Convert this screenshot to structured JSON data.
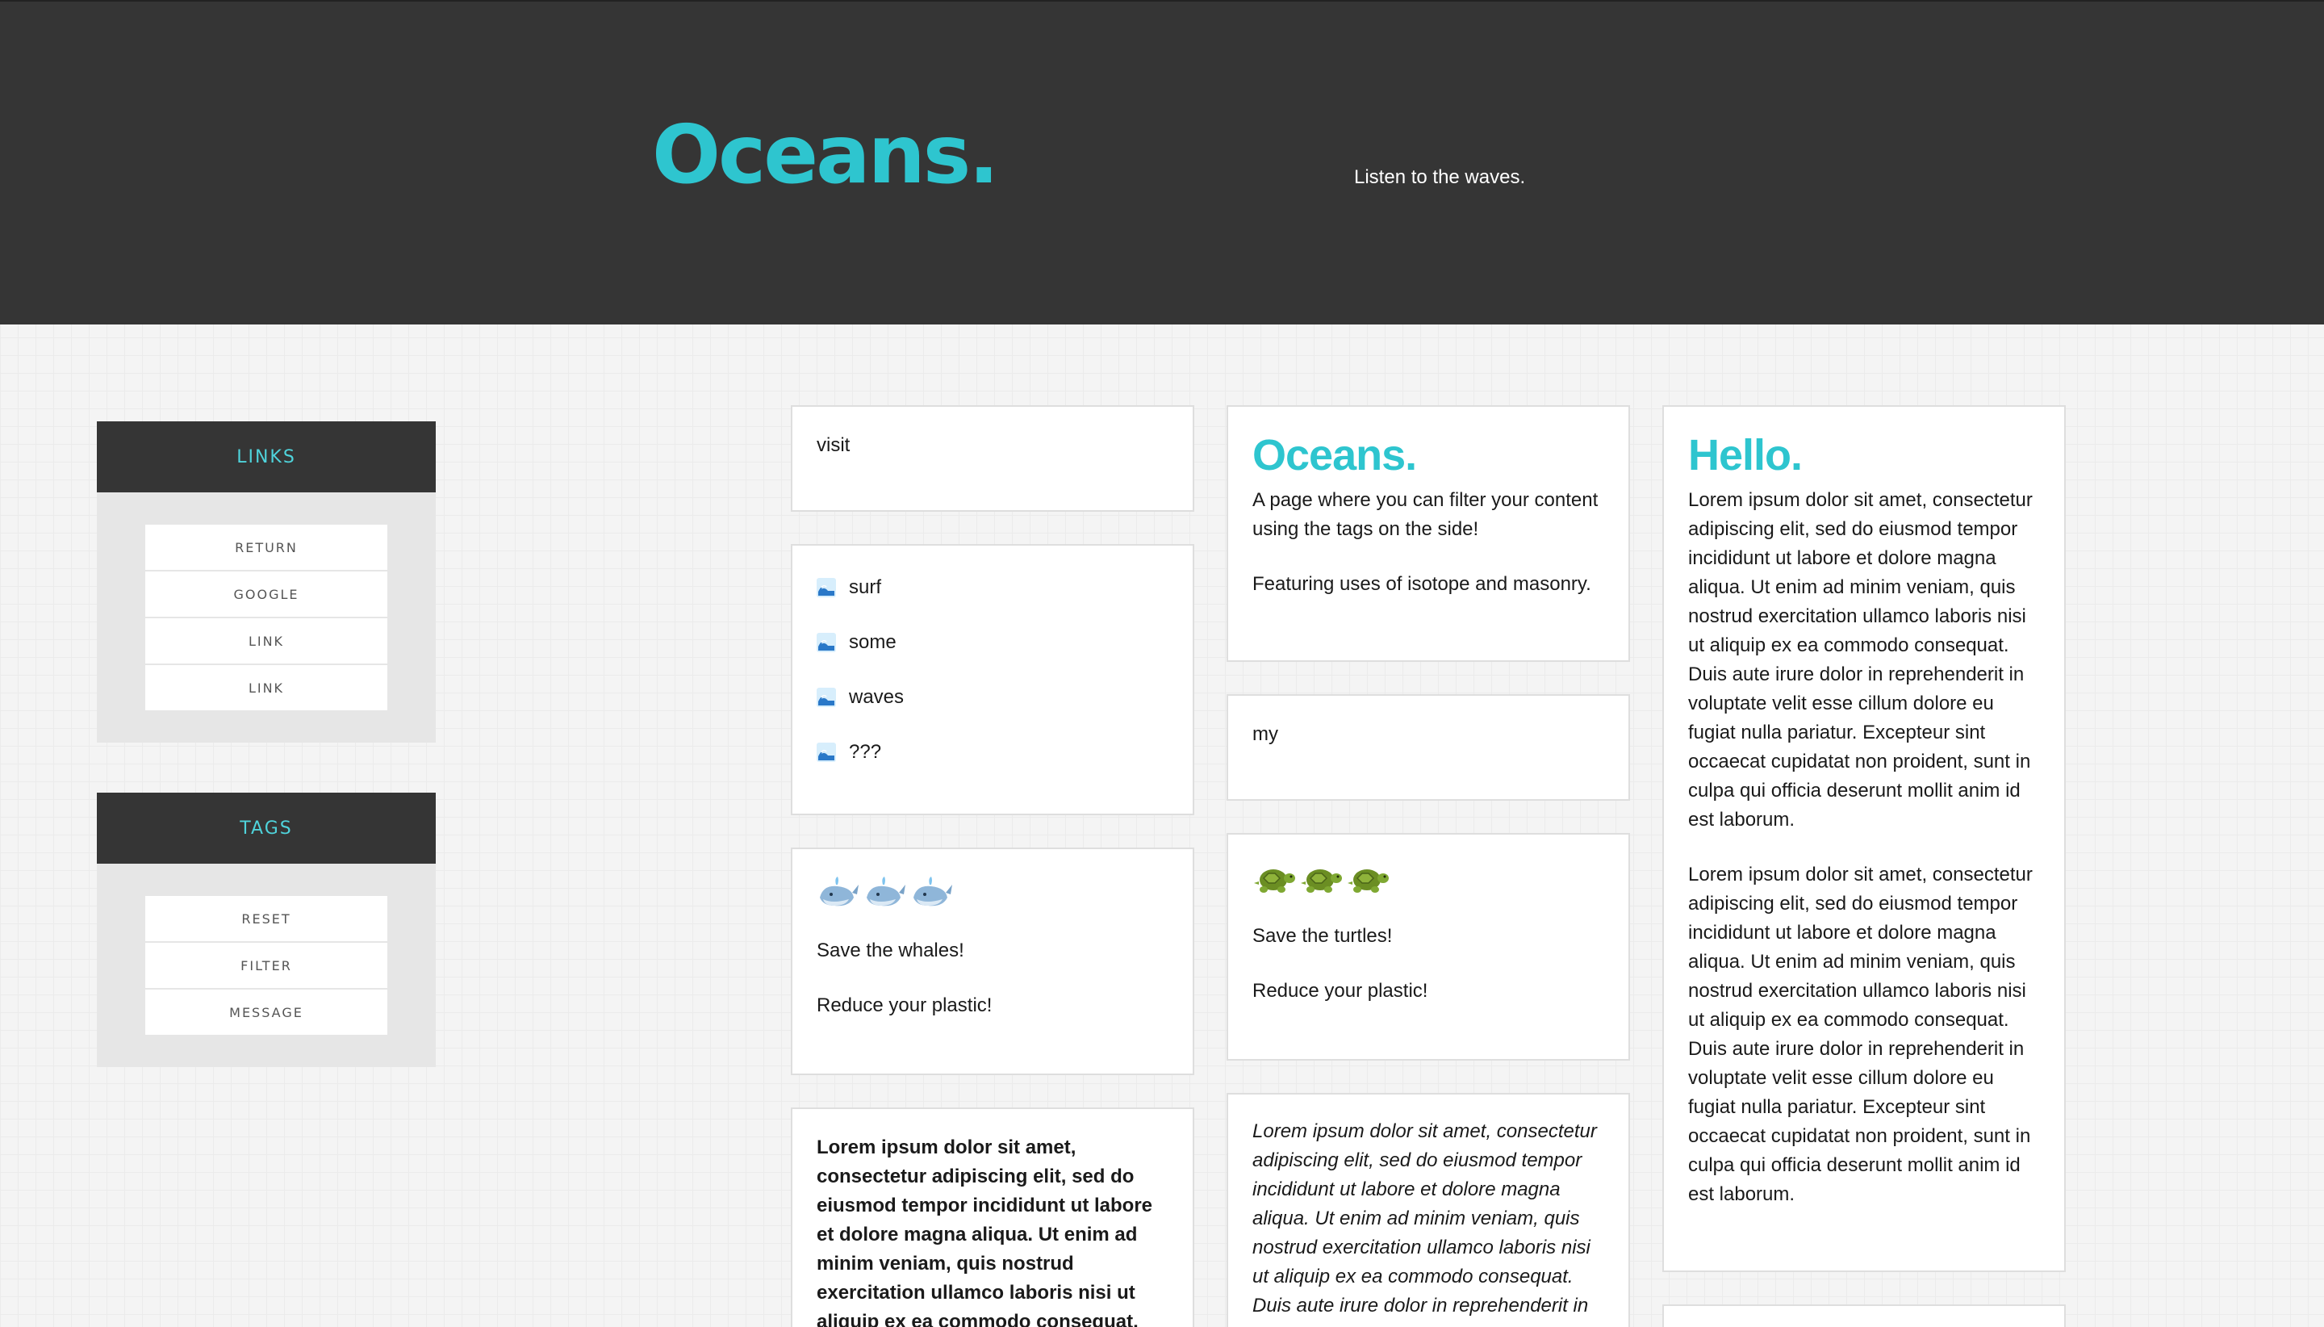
{
  "header": {
    "title": "Oceans.",
    "tagline": "Listen to the waves."
  },
  "sidebar": {
    "links": {
      "title": "LINKS",
      "items": [
        "RETURN",
        "GOOGLE",
        "LINK",
        "LINK"
      ]
    },
    "tags": {
      "title": "TAGS",
      "items": [
        "RESET",
        "FILTER",
        "MESSAGE"
      ]
    }
  },
  "cards": {
    "visit": {
      "text": "visit"
    },
    "waves": {
      "items": [
        "surf",
        "some",
        "waves",
        "???"
      ],
      "icon": "wave-icon"
    },
    "whales": {
      "icon": "whale-icon",
      "line1": "Save the whales!",
      "line2": "Reduce your plastic!"
    },
    "bold": {
      "text": "Lorem ipsum dolor sit amet, consectetur adipiscing elit, sed do eiusmod tempor incididunt ut labore et dolore magna aliqua. Ut enim ad minim veniam, quis nostrud exercitation ullamco laboris nisi ut aliquip ex ea commodo consequat."
    },
    "oceans": {
      "title": "Oceans.",
      "line1": "A page where you can filter your content using the tags on the side!",
      "line2": "Featuring uses of isotope and masonry."
    },
    "my": {
      "text": "my"
    },
    "turtles": {
      "icon": "turtle-icon",
      "line1": "Save the turtles!",
      "line2": "Reduce your plastic!"
    },
    "italic": {
      "text": "Lorem ipsum dolor sit amet, consectetur adipiscing elit, sed do eiusmod tempor incididunt ut labore et dolore magna aliqua. Ut enim ad minim veniam, quis nostrud exercitation ullamco laboris nisi ut aliquip ex ea commodo consequat. Duis aute irure dolor in reprehenderit in"
    },
    "hello": {
      "title": "Hello.",
      "para1": "Lorem ipsum dolor sit amet, consectetur adipiscing elit, sed do eiusmod tempor incididunt ut labore et dolore magna aliqua. Ut enim ad minim veniam, quis nostrud exercitation ullamco laboris nisi ut aliquip ex ea commodo consequat. Duis aute irure dolor in reprehenderit in voluptate velit esse cillum dolore eu fugiat nulla pariatur. Excepteur sint occaecat cupidatat non proident, sunt in culpa qui officia deserunt mollit anim id est laborum.",
      "para2": "Lorem ipsum dolor sit amet, consectetur adipiscing elit, sed do eiusmod tempor incididunt ut labore et dolore magna aliqua. Ut enim ad minim veniam, quis nostrud exercitation ullamco laboris nisi ut aliquip ex ea commodo consequat. Duis aute irure dolor in reprehenderit in voluptate velit esse cillum dolore eu fugiat nulla pariatur. Excepteur sint occaecat cupidatat non proident, sunt in culpa qui officia deserunt mollit anim id est laborum."
    }
  },
  "colors": {
    "accent": "#2ec5cf",
    "header_bg": "#353535",
    "panel_bg": "#e6e6e6"
  }
}
